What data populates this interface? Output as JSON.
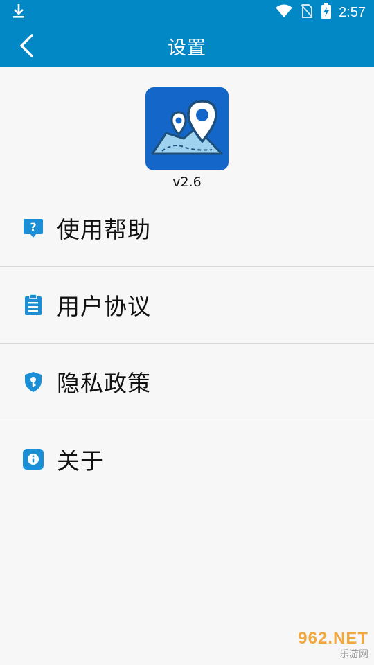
{
  "status_bar": {
    "time": "2:57",
    "icons": [
      "download-icon",
      "wifi-icon",
      "no-sim-icon",
      "battery-charging-icon"
    ]
  },
  "app_bar": {
    "title": "设置",
    "back_icon": "chevron-left-icon"
  },
  "app_info": {
    "logo_icon": "map-pin-icon",
    "version": "v2.6"
  },
  "menu": {
    "items": [
      {
        "label": "使用帮助",
        "icon": "help-icon"
      },
      {
        "label": "用户协议",
        "icon": "clipboard-icon"
      },
      {
        "label": "隐私政策",
        "icon": "shield-key-icon"
      },
      {
        "label": "关于",
        "icon": "info-icon"
      }
    ]
  },
  "watermark": {
    "brand": "962.NET",
    "sub": "乐游网"
  },
  "colors": {
    "primary": "#0288c5",
    "icon_blue": "#1b8fd6",
    "logo_bg": "#1466c8"
  }
}
